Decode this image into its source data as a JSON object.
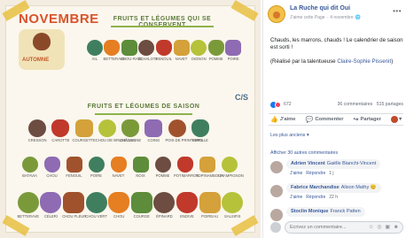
{
  "calendar": {
    "month": "NOVEMBRE",
    "badge_text": "AUTOMNE",
    "section_keep_title": "FRUITS ET LÉGUMES QUI SE CONSERVENT",
    "section_season_title": "FRUITS ET LÉGUMES DE SAISON",
    "corner_badge": "C/S",
    "keep_items": [
      "AIL",
      "BETTERAVE",
      "CHOU-RAVE",
      "ÉCHALOTE",
      "FENOUIL",
      "NAVET",
      "OIGNON",
      "POMME",
      "POIRE"
    ],
    "season_row1": [
      "CRESSON",
      "CAROTTE",
      "COURGETTE",
      "CHOU DE BRUXELLES",
      "CHÂTAIGNE",
      "COING",
      "POIS DE PRINTEMPS",
      "GIROLLE"
    ],
    "season_row2": [
      "BATAVIA",
      "CHOU",
      "FENOUIL",
      "POIRE",
      "NAVET",
      "NOIX",
      "POMME",
      "POTIMARRON",
      "TOPINAMBOUR",
      "CHAMPIGNON"
    ],
    "season_row3": [
      "BETTERAVE",
      "CÉLERI",
      "CHOU FLEUR",
      "CHOU VERT",
      "CHOU",
      "COURGE",
      "ÉPINARD",
      "ENDIVE",
      "POIREAU",
      "SALSIFIS"
    ],
    "colors": {
      "title": "#d9532b",
      "accent_green": "#8fb34a",
      "tape": "#e9c24a"
    }
  },
  "post": {
    "page_name": "La Ruche qui dit Oui",
    "like_page": "J'aime cette Page",
    "date": "4 novembre",
    "more_icon": "more-dots-icon",
    "text_line1": "Chauds, les marrons, chauds ! Le calendrier de saison est sorti !",
    "text_line2_prefix": "(Réalisé par la talentueuse ",
    "text_line2_link": "Claire-Sophie Pissenit",
    "text_line2_suffix": ")",
    "reaction_count": "672",
    "comments_count": "36 commentaires",
    "shares_count": "515 partages",
    "actions": {
      "like": "J'aime",
      "comment": "Commenter",
      "share": "Partager"
    },
    "sort_label": "Les plus anciens ▾",
    "more_comments": "Afficher 30 autres commentaires",
    "comments": [
      {
        "author": "Adrien Vincent",
        "tag": "Gaëlle Bianchi-Vincent",
        "like": "J'aime",
        "reply": "Répondre",
        "time": "1 j"
      },
      {
        "author": "Fabrice Marchandise",
        "tag": "Alison Mathy 😊",
        "like": "J'aime",
        "reply": "Répondre",
        "time": "22 h"
      },
      {
        "author": "Stoclin Monique",
        "tag": "Franck Patten",
        "like": "",
        "reply": "",
        "time": ""
      }
    ],
    "comment_placeholder": "Écrivez un commentaire...",
    "colors": {
      "link": "#385898",
      "muted": "#90949c",
      "like_blue": "#1877f2"
    }
  }
}
